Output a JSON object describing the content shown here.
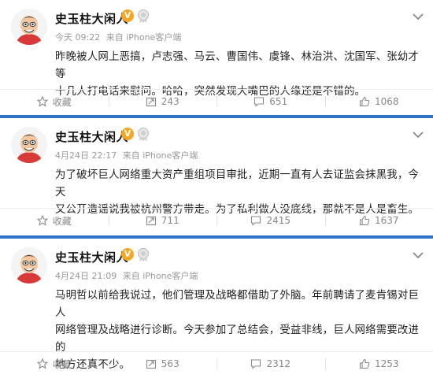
{
  "user": {
    "name": "史玉柱大闲人"
  },
  "badges": {
    "verified": "V"
  },
  "posts": [
    {
      "time": "今天 09:22",
      "source": "来自 iPhone客户端",
      "text": "昨晚被人网上恶搞，卢志强、马云、曹国伟、虞锋、林治洪、沈国军、张幼才等\n十几人打电话来慰问。哈哈，突然发现大嘴巴的人缘还是不错的。",
      "actions": {
        "collect": "收藏",
        "repost": "243",
        "comment": "651",
        "like": "1068"
      }
    },
    {
      "time": "4月24日 22:17",
      "source": "来自 iPhone客户端",
      "text": "为了破坏巨人网络重大资产重组项目审批，近期一直有人去证监会抹黑我，今天\n又公开造谣说我被杭州警方带走。为了私利做人没底线，那就不是人是畜生。",
      "actions": {
        "collect": "收藏",
        "repost": "711",
        "comment": "2415",
        "like": "1637"
      }
    },
    {
      "time": "4月24日 21:09",
      "source": "来自 iPhone客户端",
      "text": "马明哲以前给我说过，他们管理及战略都借助了外脑。年前聘请了麦肯锡对巨人\n网络管理及战略进行诊断。今天参加了总结会，受益非线，巨人网络需要改进的\n地方还真不少。",
      "actions": {
        "collect": "收藏",
        "repost": "563",
        "comment": "2312",
        "like": "1253"
      }
    }
  ],
  "colors": {
    "divider": "#2d73c8",
    "badge": "#f6a623",
    "meta": "#999999"
  },
  "icons": [
    "avatar-cartoon",
    "verified-v-icon",
    "medal-icon",
    "chevron-down-icon",
    "star-icon",
    "repost-icon",
    "comment-icon",
    "like-icon"
  ]
}
